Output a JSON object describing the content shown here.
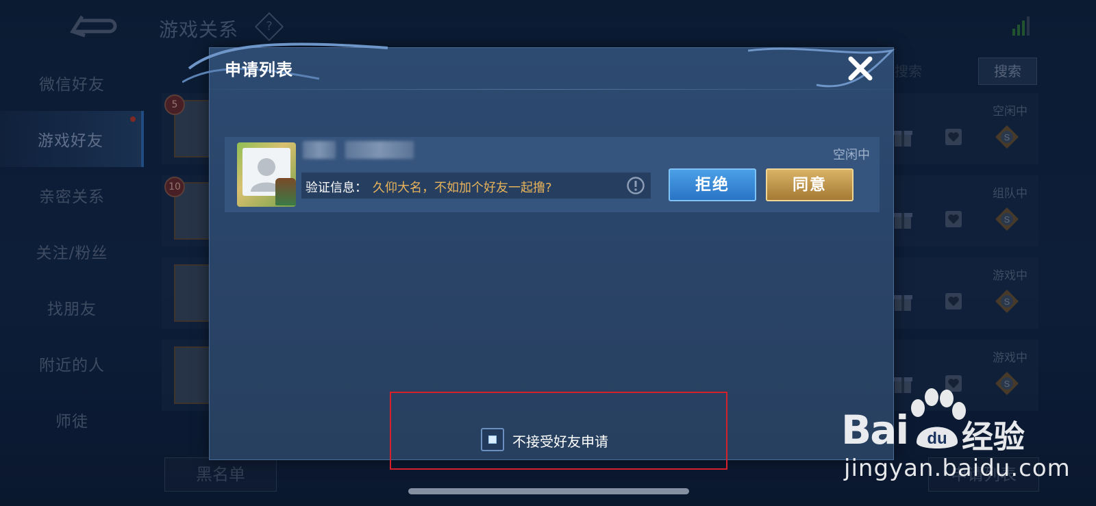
{
  "background": {
    "page_title": "游戏关系",
    "help_glyph": "?",
    "sidebar": [
      {
        "label": "微信好友",
        "active": false
      },
      {
        "label": "游戏好友",
        "active": true
      },
      {
        "label": "亲密关系",
        "active": false
      },
      {
        "label": "关注/粉丝",
        "active": false
      },
      {
        "label": "找朋友",
        "active": false
      },
      {
        "label": "附近的人",
        "active": false
      },
      {
        "label": "师徒",
        "active": false
      }
    ],
    "search_placeholder": "行搜索",
    "search_button": "搜索",
    "friends": [
      {
        "level": "5",
        "status": "空闲中"
      },
      {
        "level": "10",
        "status": "组队中"
      },
      {
        "level": "",
        "status": "游戏中"
      },
      {
        "level": "",
        "status": "游戏中"
      }
    ],
    "blacklist_button": "黑名单",
    "apply_list_button": "申请列表"
  },
  "modal": {
    "title": "申请列表",
    "request": {
      "status": "空闲中",
      "verify_label": "验证信息：",
      "verify_message": "久仰大名，不如加个好友一起撸?",
      "reject_label": "拒绝",
      "accept_label": "同意"
    },
    "decline_all_checkbox": {
      "label": "不接受好友申请",
      "checked": true
    }
  },
  "watermark": {
    "logo_text": "Bai",
    "logo_du": "du",
    "cn_text": "经验",
    "url": "jingyan.baidu.com"
  },
  "colors": {
    "accent_blue": "#2a74c6",
    "accent_gold": "#c49a4c",
    "highlight_red": "#d6202a",
    "verify_text": "#e8b35a"
  }
}
